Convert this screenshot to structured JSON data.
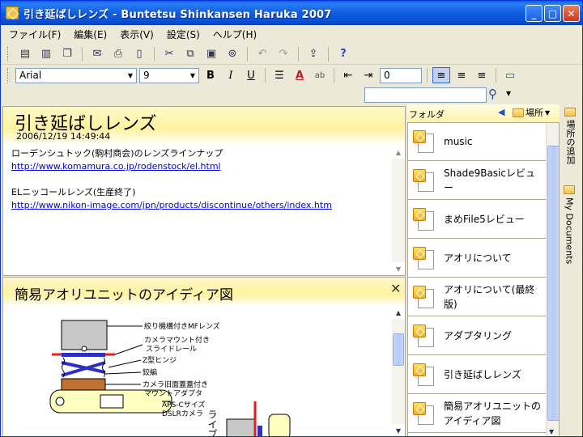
{
  "window": {
    "title": "引き延ばしレンズ - Buntetsu Shinkansen Haruka 2007",
    "minimize": "_",
    "maximize": "□",
    "close": "✕"
  },
  "menu": [
    "ファイル(F)",
    "編集(E)",
    "表示(V)",
    "設定(S)",
    "ヘルプ(H)"
  ],
  "format": {
    "font": "Arial",
    "size": "9",
    "indent_value": "0",
    "bold": "B",
    "italic": "I",
    "underline": "U"
  },
  "search": {
    "placeholder": ""
  },
  "note1": {
    "title": "引き延ばしレンズ",
    "date": "2006/12/19 14:49:44",
    "line1": "ローデンシュトック(駒村商会)のレンズラインナップ",
    "link1": "http://www.komamura.co.jp/rodenstock/el.html",
    "line2": "ELニッコールレンズ(生産終了)",
    "link2": "http://www.nikon-image.com/jpn/products/discontinue/others/index.htm"
  },
  "note2": {
    "title": "簡易アオリユニットのアイディア図",
    "close": "✕",
    "figure": {
      "lbl1": "絞り機構付きMFレンズ",
      "lbl2a": "カメラマウント付き",
      "lbl2b": "スライドレール",
      "lbl3": "Z型ヒンジ",
      "lbl4": "鉸編",
      "lbl5a": "カメラ旧面蓋蓋付き",
      "lbl5b": "マウントアダプタ",
      "lbl6a": "APS-Cサイズ",
      "lbl6b": "DSLRカメラ",
      "side": "ライブ"
    }
  },
  "folder_pane": {
    "label": "フォルダ",
    "place": "場所",
    "items": [
      "music",
      "Shade9Basicレビュー",
      "まめFile5レビュー",
      "アオリについて",
      "アオリについて(最終版)",
      "アダプタリング",
      "引き延ばしレンズ",
      "簡易アオリユニットのアイディア図"
    ]
  },
  "side_tabs": {
    "tab1": "場所の追加",
    "tab2": "My Documents"
  },
  "colors": {
    "titlebar": "#0A5FE8",
    "note_header": "#FFF3A0",
    "link": "#0000EE"
  }
}
